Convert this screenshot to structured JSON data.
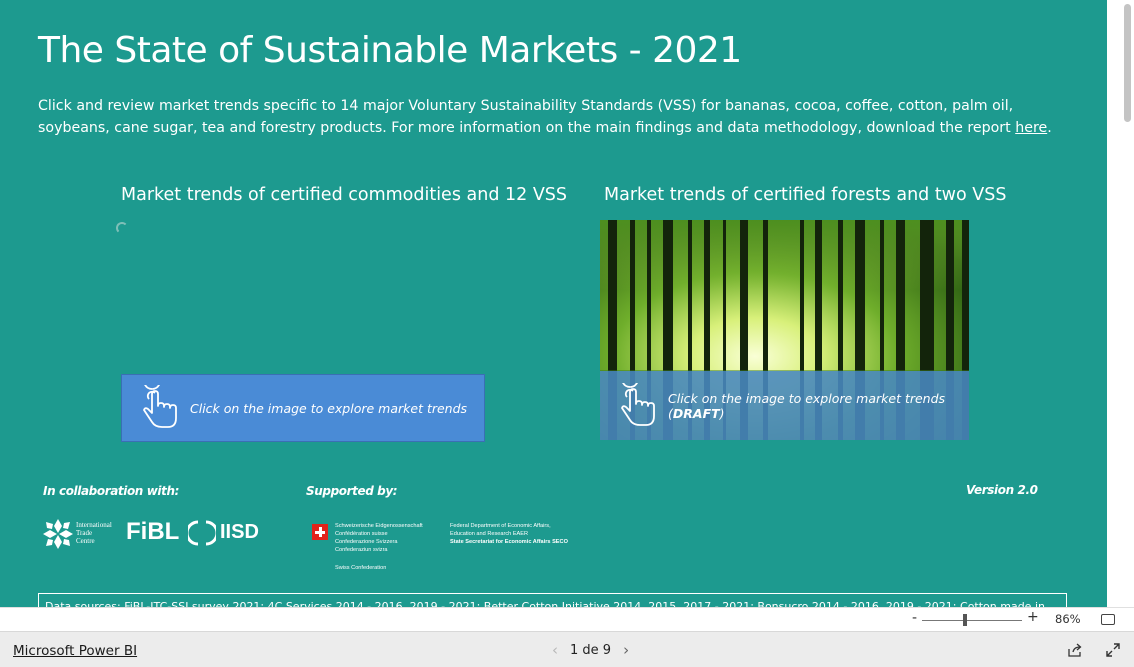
{
  "report": {
    "title": "The State of Sustainable Markets - 2021",
    "intro_text": "Click and review market trends specific to 14 major Voluntary Sustainability Standards (VSS) for bananas, cocoa, coffee, cotton, palm oil, soybeans, cane sugar, tea and forestry products. For more information on the main findings and data methodology, download the report ",
    "intro_link": "here",
    "intro_end": ".",
    "left_section_title": "Market trends of certified commodities and 12 VSS",
    "right_section_title": "Market trends of certified forests and two VSS",
    "left_cta": "Click on the image to explore market trends",
    "right_cta_main": "Click on the image to explore market trends (",
    "right_cta_bold": "DRAFT",
    "right_cta_end": ")",
    "collab_label": "In collaboration with:",
    "supported_label": "Supported by:",
    "version": "Version 2.0",
    "logos": {
      "itc_line1": "International",
      "itc_line2": "Trade",
      "itc_line3": "Centre",
      "fibl": "FiBL",
      "iisd": "IISD",
      "swiss_lines": [
        "Schweizerische Eidgenossenschaft",
        "Confédération suisse",
        "Confederazione Svizzera",
        "Confederaziun svizra"
      ],
      "swiss_conf": "Swiss Confederation",
      "fdea_lines": [
        "Federal Department of Economic Affairs,",
        "Education and Research EAER"
      ],
      "seco": "State Secretariat for Economic Affairs SECO"
    },
    "datatable_text": "Data sources: FiBL-ITC-SSI survey 2021; 4C Services 2014 - 2016, 2019 - 2021; Better Cotton Initiative 2014, 2015, 2017 - 2021; Bonsucro 2014 - 2016, 2019 - 2021; Cotton made in"
  },
  "footer": {
    "brand": "Microsoft Power BI",
    "page_indicator": "1 de 9",
    "zoom_minus": "-",
    "zoom_plus": "+",
    "zoom_level": "86%"
  },
  "colors": {
    "background": "#1d9a8f",
    "cta_blue": "#4a8bd6"
  },
  "icons": [
    "pointer-hand-icon",
    "share-icon",
    "expand-icon",
    "fit-page-icon",
    "chevron-left-icon",
    "chevron-right-icon",
    "loading-spinner-icon"
  ]
}
